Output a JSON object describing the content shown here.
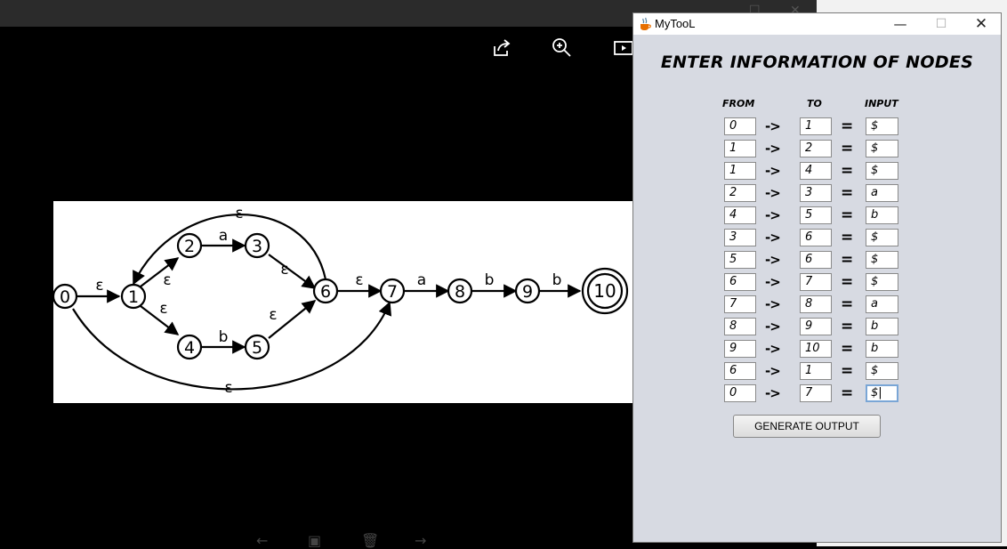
{
  "app": {
    "title": "MyTooL",
    "heading": "ENTER INFORMATION OF NODES",
    "columns": {
      "from": "FROM",
      "to": "TO",
      "input": "INPUT"
    },
    "arrow_symbol": "->",
    "equals_symbol": "=",
    "rows": [
      {
        "from": "0",
        "to": "1",
        "input": "$"
      },
      {
        "from": "1",
        "to": "2",
        "input": "$"
      },
      {
        "from": "1",
        "to": "4",
        "input": "$"
      },
      {
        "from": "2",
        "to": "3",
        "input": "a"
      },
      {
        "from": "4",
        "to": "5",
        "input": "b"
      },
      {
        "from": "3",
        "to": "6",
        "input": "$"
      },
      {
        "from": "5",
        "to": "6",
        "input": "$"
      },
      {
        "from": "6",
        "to": "7",
        "input": "$"
      },
      {
        "from": "7",
        "to": "8",
        "input": "a"
      },
      {
        "from": "8",
        "to": "9",
        "input": "b"
      },
      {
        "from": "9",
        "to": "10",
        "input": "b"
      },
      {
        "from": "6",
        "to": "1",
        "input": "$"
      },
      {
        "from": "0",
        "to": "7",
        "input": "$|"
      }
    ],
    "generate_button": "GENERATE OUTPUT",
    "window_buttons": {
      "minimize": "—",
      "maximize": "☐",
      "close": "✕"
    }
  },
  "diagram": {
    "nodes": [
      "0",
      "1",
      "2",
      "3",
      "4",
      "5",
      "6",
      "7",
      "8",
      "9",
      "10"
    ],
    "edge_labels": {
      "e01": "ε",
      "e12": "ε",
      "e14": "ε",
      "e23": "a",
      "e45": "b",
      "e36": "ε",
      "e56": "ε",
      "e67": "ε",
      "e78": "a",
      "e89": "b",
      "e910": "b",
      "e61": "ε",
      "e07": "ε"
    },
    "accepting_node": "10"
  },
  "viewer": {
    "tools": [
      "share-icon",
      "zoom-in-icon",
      "slideshow-icon"
    ],
    "bottom_tools": [
      "back-icon",
      "save-icon",
      "delete-icon",
      "forward-icon"
    ]
  },
  "colors": {
    "window_bg": "#d7dae2",
    "viewer_bg": "#000000",
    "focus_border": "#7aa6d6"
  }
}
